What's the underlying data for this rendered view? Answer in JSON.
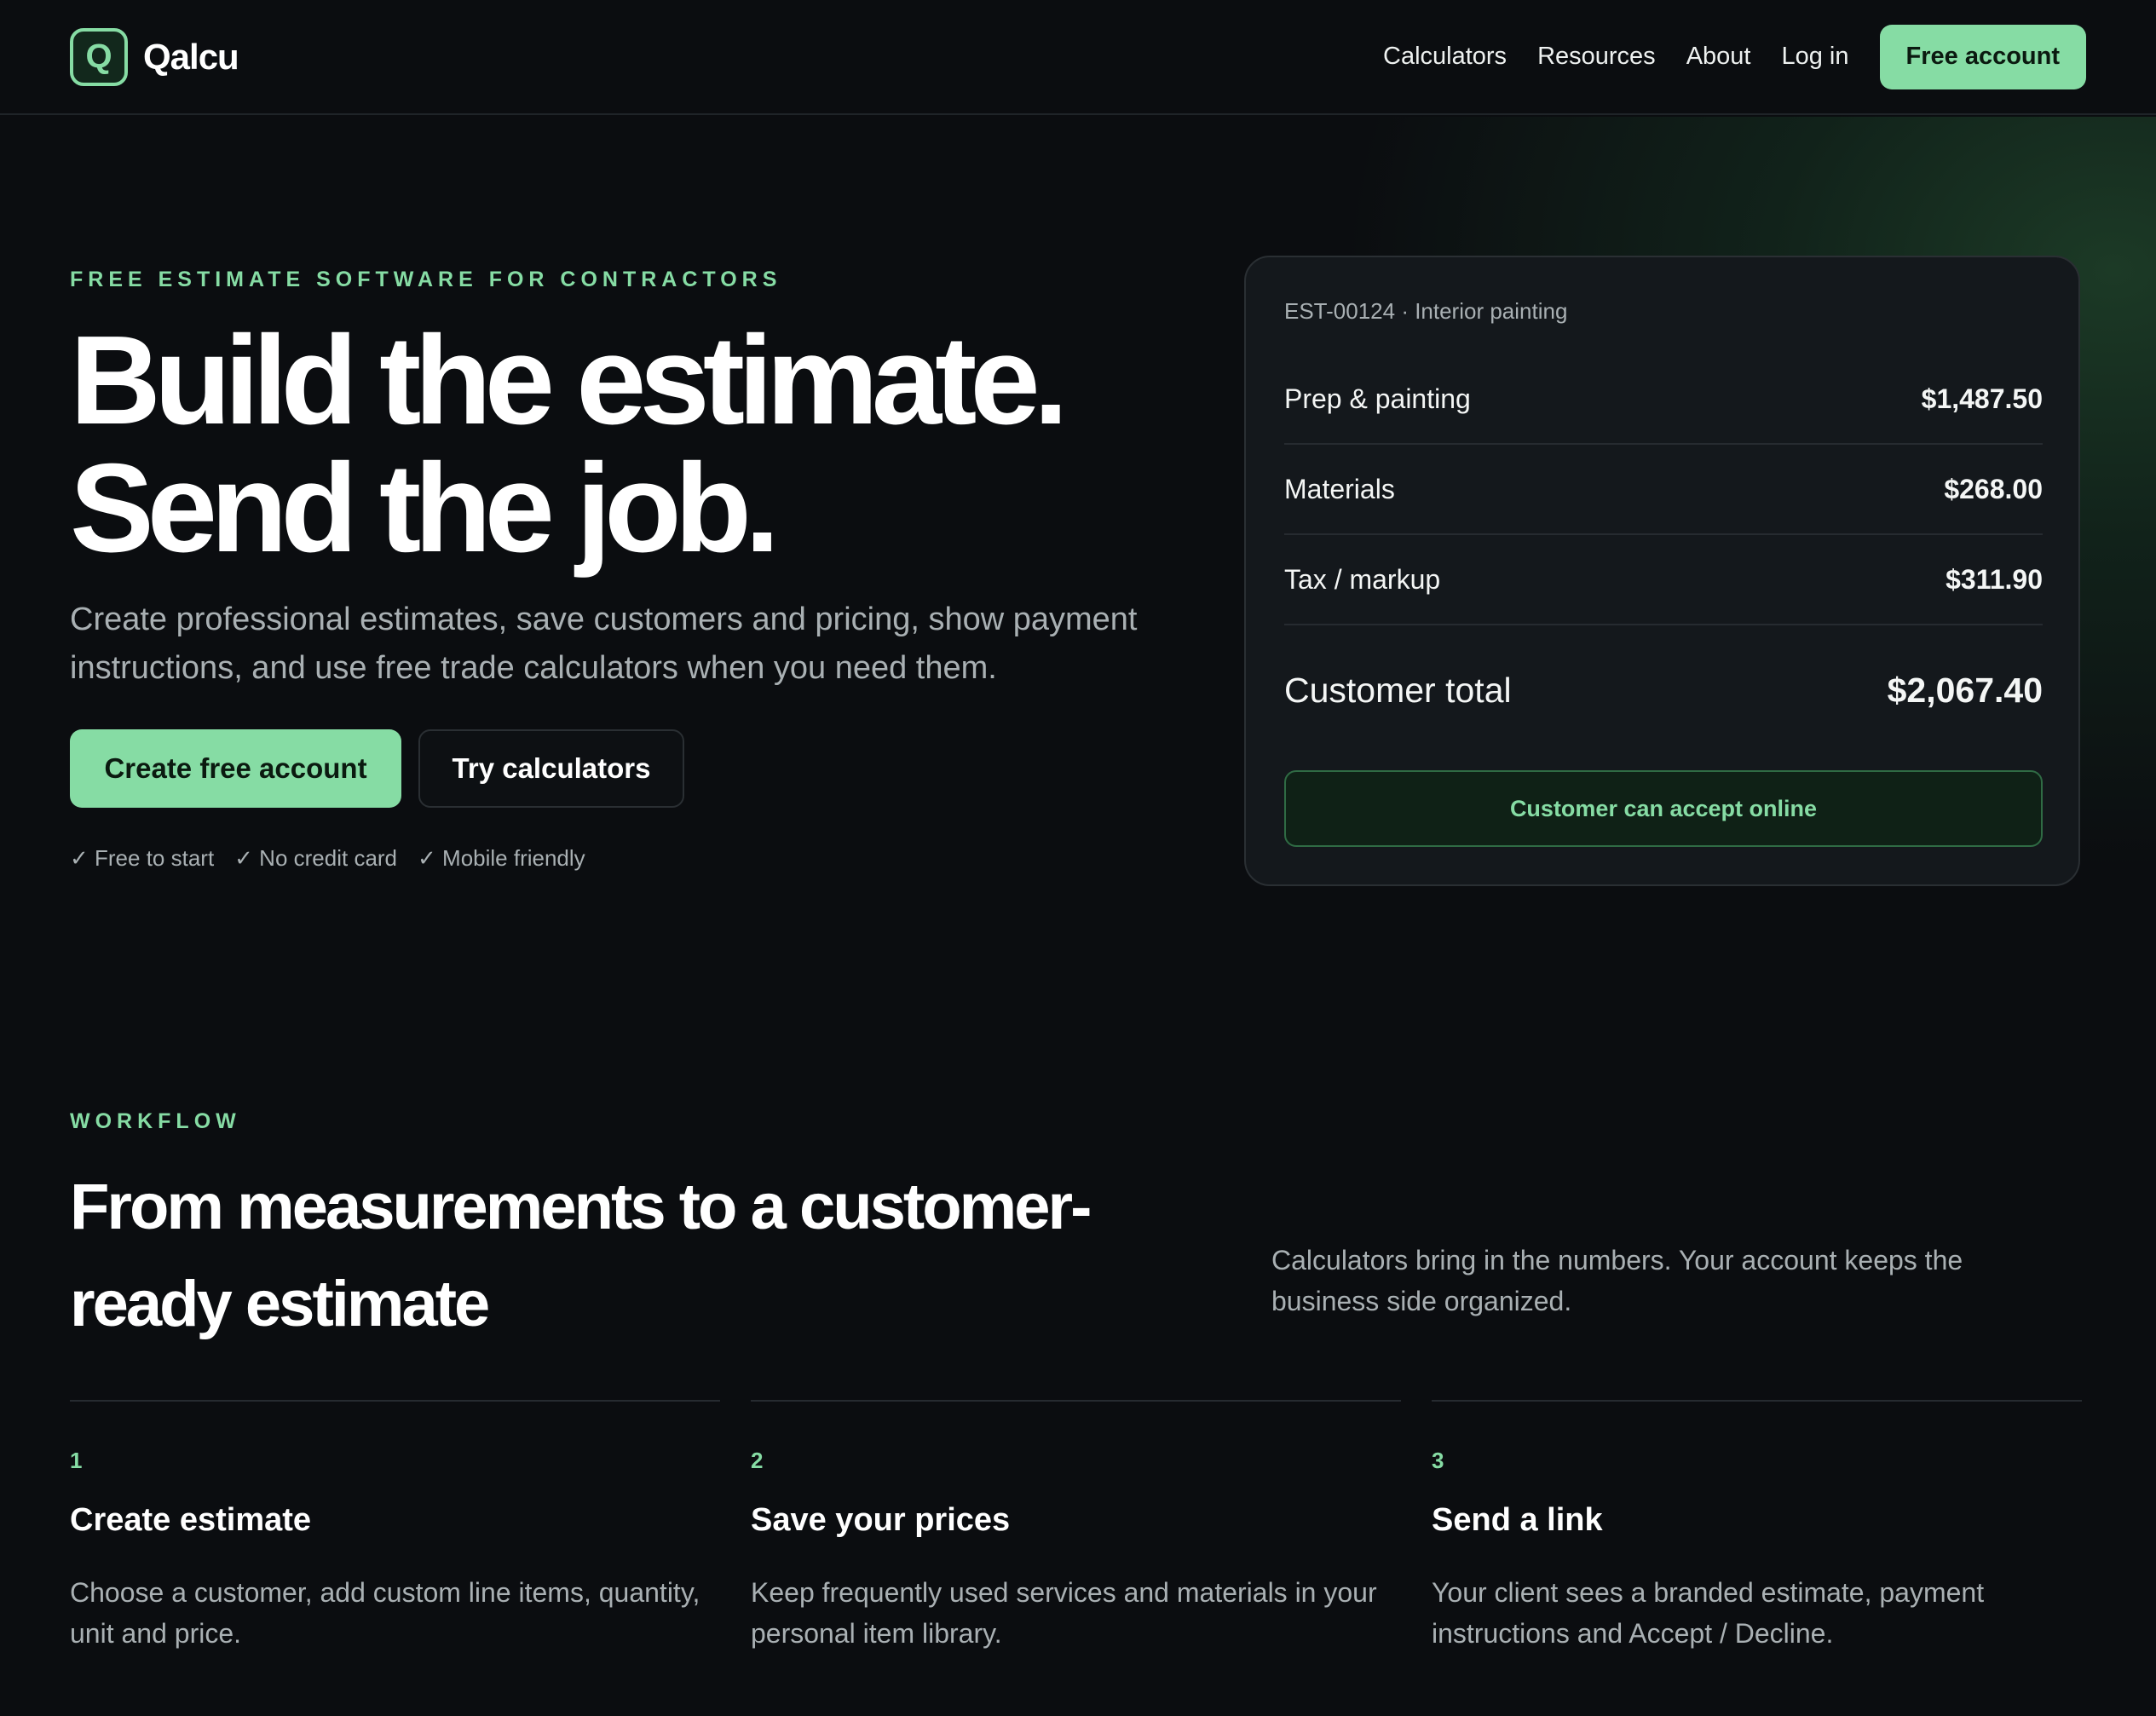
{
  "nav": {
    "brand": "Qalcu",
    "logo_letter": "Q",
    "links": [
      "Calculators",
      "Resources",
      "About",
      "Log in"
    ],
    "cta": "Free account"
  },
  "hero": {
    "eyebrow": "FREE ESTIMATE SOFTWARE FOR CONTRACTORS",
    "title_line1": "Build the estimate.",
    "title_line2": "Send the job.",
    "subtitle": "Create professional estimates, save customers and pricing, show payment instructions, and use free trade calculators when you need them.",
    "primary_button": "Create free account",
    "secondary_button": "Try calculators",
    "checks": [
      "✓ Free to start",
      "✓ No credit card",
      "✓ Mobile friendly"
    ]
  },
  "estimate": {
    "header": "EST-00124 · Interior painting",
    "rows": [
      {
        "label": "Prep & painting",
        "amount": "$1,487.50"
      },
      {
        "label": "Materials",
        "amount": "$268.00"
      },
      {
        "label": "Tax / markup",
        "amount": "$311.90"
      }
    ],
    "total_label": "Customer total",
    "total_amount": "$2,067.40",
    "accept_button": "Customer can accept online"
  },
  "workflow": {
    "eyebrow": "WORKFLOW",
    "title": "From measurements to a customer-ready estimate",
    "side_text": "Calculators bring in the numbers. Your account keeps the business side organized.",
    "steps": [
      {
        "num": "1",
        "title": "Create estimate",
        "desc": "Choose a customer, add custom line items, quantity, unit and price."
      },
      {
        "num": "2",
        "title": "Save your prices",
        "desc": "Keep frequently used services and materials in your personal item library."
      },
      {
        "num": "3",
        "title": "Send a link",
        "desc": "Your client sees a branded estimate, payment instructions and Accept / Decline."
      }
    ]
  },
  "colors": {
    "accent": "#86dca4",
    "background": "#0b0d10",
    "card": "#14181c",
    "muted_text": "#a9b0b3"
  }
}
